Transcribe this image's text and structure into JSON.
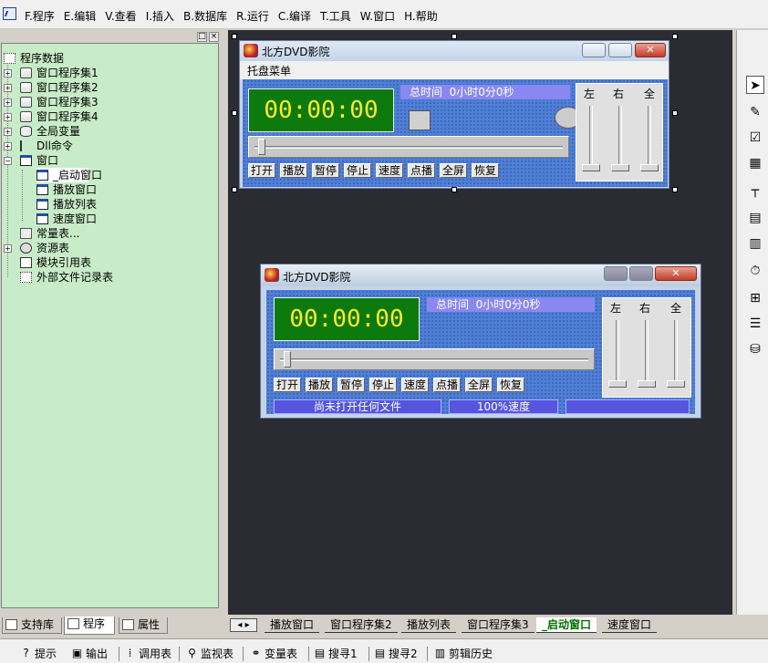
{
  "menubar": {
    "items": [
      "F.程序",
      "E.编辑",
      "V.查看",
      "I.插入",
      "B.数据库",
      "R.运行",
      "C.编译",
      "T.工具",
      "W.窗口",
      "H.帮助"
    ]
  },
  "tree": {
    "root": "程序数据",
    "nodes": [
      {
        "label": "窗口程序集1"
      },
      {
        "label": "窗口程序集2"
      },
      {
        "label": "窗口程序集3"
      },
      {
        "label": "窗口程序集4"
      },
      {
        "label": "全局变量"
      },
      {
        "label": "Dll命令"
      },
      {
        "label": "窗口"
      },
      {
        "label": "_启动窗口"
      },
      {
        "label": "播放窗口"
      },
      {
        "label": "播放列表"
      },
      {
        "label": "速度窗口"
      },
      {
        "label": "常量表..."
      },
      {
        "label": "资源表"
      },
      {
        "label": "模块引用表"
      },
      {
        "label": "外部文件记录表"
      }
    ],
    "header_buttons": [
      "□",
      "×"
    ]
  },
  "left_tabs": [
    "支持库",
    "程序",
    "属性"
  ],
  "window1": {
    "title": "北方DVD影院",
    "menu": "托盘菜单",
    "time": "00:00:00",
    "total": "总时间  0小时0分0秒",
    "buttons": [
      "打开",
      "播放",
      "暂停",
      "停止",
      "速度",
      "点播",
      "全屏",
      "恢复"
    ],
    "vol_labels": [
      "左",
      "右",
      "全"
    ],
    "close": "✕"
  },
  "window2": {
    "title": "北方DVD影院",
    "time": "00:00:00",
    "total": "总时间  0小时0分0秒",
    "buttons": [
      "打开",
      "播放",
      "暂停",
      "停止",
      "速度",
      "点播",
      "全屏",
      "恢复"
    ],
    "vol_labels": [
      "左",
      "右",
      "全"
    ],
    "status": [
      "尚未打开任何文件",
      "100%速度",
      ""
    ],
    "close": "✕"
  },
  "design_tabs": [
    "播放窗口",
    "窗口程序集2",
    "播放列表",
    "窗口程序集3",
    "_启动窗口",
    "速度窗口"
  ],
  "bottom": [
    "提示",
    "输出",
    "调用表",
    "监视表",
    "变量表",
    "搜寻1",
    "搜寻2",
    "剪辑历史"
  ],
  "colors": {
    "tree_bg": "#c8ecc8",
    "design_bg": "#2b2b33",
    "client_blue": "#4f7fd7",
    "time_green": "#0c7a0c",
    "time_text": "#ffea2a",
    "total_bar": "#8a88f0"
  },
  "icons": [
    "app-icon",
    "book-icon",
    "window-icon",
    "db-icon",
    "dll-icon",
    "pointer-icon",
    "timer-icon",
    "odbc-icon"
  ]
}
